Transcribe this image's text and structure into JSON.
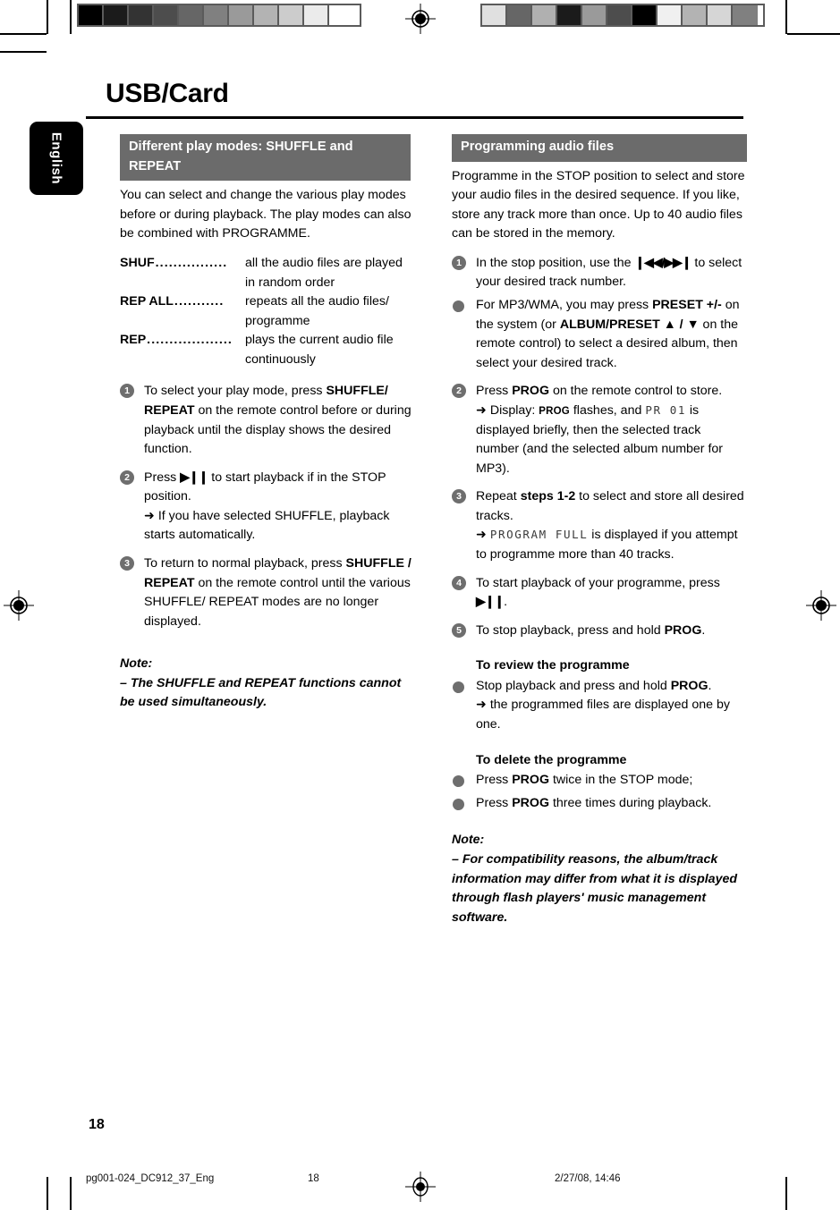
{
  "page": {
    "title": "USB/Card",
    "language_tab": "English",
    "page_number": "18"
  },
  "colors": {
    "section_bar": "#6b6b6b",
    "marker": "#6e6e6e",
    "text": "#000000",
    "lcd_text": "#3a3a3a"
  },
  "calibration": {
    "left_swatches": [
      "#000000",
      "#1b1b1b",
      "#333333",
      "#4d4d4d",
      "#666666",
      "#808080",
      "#9a9a9a",
      "#b3b3b3",
      "#cccccc",
      "#ebebeb",
      "#ffffff"
    ],
    "right_swatches": [
      "#e0e0e0",
      "#666666",
      "#b0b0b0",
      "#1b1b1b",
      "#9a9a9a",
      "#4d4d4d",
      "#000000",
      "#f0f0f0",
      "#b3b3b3",
      "#d6d6d6",
      "#808080"
    ]
  },
  "left_column": {
    "section_title": "Different play modes: SHUFFLE and REPEAT",
    "intro": "You can select and change the various play modes before or during playback. The play modes can also be combined with PROGRAMME.",
    "definitions": [
      {
        "term": "SHUF",
        "dots": "................",
        "desc": "all the audio files are played in random order"
      },
      {
        "term": "REP ALL",
        "dots": "...........",
        "desc": "repeats all the audio files/ programme"
      },
      {
        "term": "REP",
        "dots": "...................",
        "desc": "plays the current audio file continuously"
      }
    ],
    "steps": [
      {
        "marker": "1",
        "parts": [
          {
            "t": "To select your play mode, press ",
            "b": false
          },
          {
            "t": "SHUFFLE/ REPEAT",
            "b": true
          },
          {
            "t": " on the remote control before or during playback until the display shows the desired function.",
            "b": false
          }
        ]
      },
      {
        "marker": "2",
        "parts": [
          {
            "t": "Press ",
            "b": false
          },
          {
            "t": "▶❙❙",
            "b": true
          },
          {
            "t": " to start playback if in the STOP position.",
            "b": false
          }
        ],
        "sub": "➜ If you have selected SHUFFLE, playback starts automatically."
      },
      {
        "marker": "3",
        "parts": [
          {
            "t": "To return to normal playback, press ",
            "b": false
          },
          {
            "t": "SHUFFLE / REPEAT",
            "b": true
          },
          {
            "t": " on the remote control until the various SHUFFLE/ REPEAT modes are no longer displayed.",
            "b": false
          }
        ]
      }
    ],
    "note_head": "Note:",
    "note_body": "– The SHUFFLE and REPEAT functions cannot be used simultaneously."
  },
  "right_column": {
    "section_title": "Programming audio files",
    "intro": "Programme in the STOP position to select and store your audio files in the desired sequence. If you like, store any track more than once. Up to 40 audio files can be stored in the memory.",
    "step1_pre": "In the stop position, use the ",
    "step1_symbols": "❙◀◀/▶▶❙",
    "step1_post": " to select your desired track number.",
    "bullet1_pre": "For MP3/WMA, you may press ",
    "bullet1_b1": "PRESET +/-",
    "bullet1_mid": " on the system (or ",
    "bullet1_b2": "ALBUM/PRESET ▲ / ▼",
    "bullet1_post": " on the remote control) to select a desired album, then select your desired track.",
    "step2_pre": "Press ",
    "step2_b": "PROG",
    "step2_post": " on the remote control to store.",
    "step2_sub_pre": "➜ Display: ",
    "step2_sub_sc": "PROG",
    "step2_sub_mid": " flashes, and ",
    "step2_sub_lcd": "PR  01",
    "step2_sub_post": " is displayed briefly, then the selected track number (and the selected album number for MP3).",
    "step3_pre": "Repeat ",
    "step3_b": "steps 1-2",
    "step3_post": " to select and store all desired tracks.",
    "step3_sub_arrow": "➜ ",
    "step3_sub_lcd": "PROGRAM FULL",
    "step3_sub_post": " is displayed if you attempt to programme more than 40 tracks.",
    "step4_pre": "To start playback of your programme, press ",
    "step4_sym": "▶❙❙",
    "step4_post": ".",
    "step5_pre": "To stop playback, press and hold ",
    "step5_b": "PROG",
    "step5_post": ".",
    "review_head": "To review the programme",
    "review_pre": "Stop playback and press and hold ",
    "review_b": "PROG",
    "review_post": ".",
    "review_sub": "➜ the programmed files are displayed one by one.",
    "delete_head": "To delete the programme",
    "delete_b1_pre": "Press ",
    "delete_b1_b": "PROG",
    "delete_b1_post": " twice in the STOP mode;",
    "delete_b2_pre": "Press ",
    "delete_b2_b": "PROG",
    "delete_b2_post": " three times during playback.",
    "note_head": "Note:",
    "note_body": "–  For compatibility reasons, the album/track information may differ from what it is displayed through flash players' music management software."
  },
  "footer": {
    "file": "pg001-024_DC912_37_Eng",
    "page": "18",
    "date": "2/27/08, 14:46"
  }
}
